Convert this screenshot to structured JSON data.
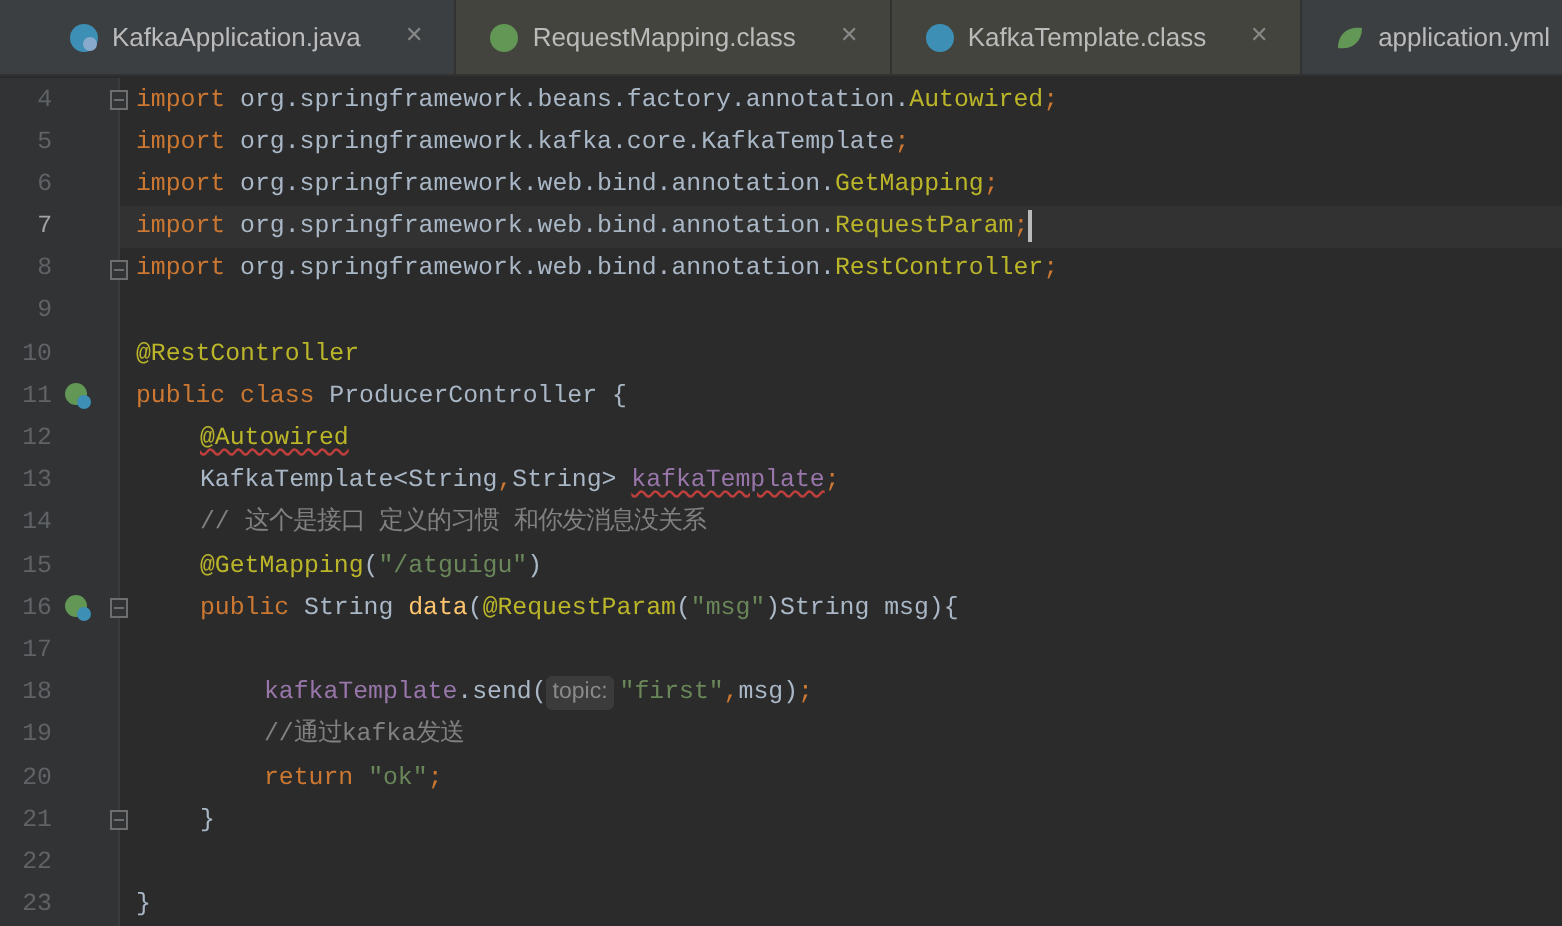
{
  "tabs": [
    {
      "label": "KafkaApplication.java",
      "kind": "app",
      "close": "✕"
    },
    {
      "label": "RequestMapping.class",
      "kind": "annotation",
      "close": "✕"
    },
    {
      "label": "KafkaTemplate.class",
      "kind": "class",
      "close": "✕"
    },
    {
      "label": "application.yml",
      "kind": "spring"
    }
  ],
  "lines": [
    {
      "number": "4",
      "kind": "top",
      "current": false,
      "fold": true,
      "tokens": [
        {
          "kind": "kw",
          "text": "import"
        },
        {
          "kind": "plain",
          "text": " org.springframework.beans.factory.annotation."
        },
        {
          "kind": "ann",
          "text": "Autowired"
        },
        {
          "kind": "punct",
          "text": ";"
        }
      ]
    },
    {
      "number": "5",
      "kind": "top",
      "current": false,
      "fold": false,
      "tokens": [
        {
          "kind": "kw",
          "text": "import"
        },
        {
          "kind": "plain",
          "text": " org.springframework.kafka.core.KafkaTemplate"
        },
        {
          "kind": "punct",
          "text": ";"
        }
      ]
    },
    {
      "number": "6",
      "kind": "top",
      "current": false,
      "fold": false,
      "tokens": [
        {
          "kind": "kw",
          "text": "import"
        },
        {
          "kind": "plain",
          "text": " org.springframework.web.bind.annotation."
        },
        {
          "kind": "ann",
          "text": "GetMapping"
        },
        {
          "kind": "punct",
          "text": ";"
        }
      ]
    },
    {
      "number": "7",
      "kind": "top",
      "current": true,
      "fold": false,
      "tokens": [
        {
          "kind": "kw",
          "text": "import"
        },
        {
          "kind": "plain",
          "text": " org.springframework.web.bind.annotation."
        },
        {
          "kind": "ann",
          "text": "RequestParam"
        },
        {
          "kind": "punct",
          "text": ";"
        }
      ]
    },
    {
      "number": "8",
      "kind": "top",
      "current": false,
      "fold": true,
      "tokens": [
        {
          "kind": "kw",
          "text": "import"
        },
        {
          "kind": "plain",
          "text": " org.springframework.web.bind.annotation."
        },
        {
          "kind": "ann",
          "text": "RestController"
        },
        {
          "kind": "punct",
          "text": ";"
        }
      ]
    },
    {
      "number": "9",
      "kind": "top",
      "current": false,
      "fold": false
    },
    {
      "number": "10",
      "kind": "top",
      "current": false,
      "fold": false,
      "tokens": [
        {
          "kind": "ann",
          "text": "@RestController"
        }
      ]
    },
    {
      "number": "11",
      "kind": "top",
      "current": false,
      "fold": false,
      "marker": true,
      "tokens": [
        {
          "kind": "kw",
          "text": "public class"
        },
        {
          "kind": "plain",
          "text": " ProducerController {"
        }
      ]
    },
    {
      "number": "12",
      "kind": "member",
      "current": false,
      "fold": false,
      "tokens": [
        {
          "kind": "ann",
          "text": "@Autowired",
          "squiggle": true
        }
      ]
    },
    {
      "number": "13",
      "kind": "member",
      "current": false,
      "fold": false,
      "tokens": [
        {
          "kind": "plain",
          "text": "KafkaTemplate<String"
        },
        {
          "kind": "punct",
          "text": ","
        },
        {
          "kind": "plain",
          "text": "String> "
        },
        {
          "kind": "field",
          "text": "kafkaTemplate",
          "squiggle": true
        },
        {
          "kind": "punct",
          "text": ";"
        }
      ]
    },
    {
      "number": "14",
      "kind": "member",
      "current": false,
      "fold": false,
      "tokens": [
        {
          "kind": "comment",
          "text": "// 这个是接口 定义的习惯 和你发消息没关系"
        }
      ]
    },
    {
      "number": "15",
      "kind": "member",
      "current": false,
      "fold": false,
      "tokens": [
        {
          "kind": "ann",
          "text": "@GetMapping"
        },
        {
          "kind": "plain",
          "text": "("
        },
        {
          "kind": "str",
          "text": "\"/atguigu\""
        },
        {
          "kind": "plain",
          "text": ")"
        }
      ]
    },
    {
      "number": "16",
      "kind": "member",
      "current": false,
      "fold": true,
      "marker": true,
      "tokens": [
        {
          "kind": "kw",
          "text": "public"
        },
        {
          "kind": "plain",
          "text": " String "
        },
        {
          "kind": "method",
          "text": "data"
        },
        {
          "kind": "plain",
          "text": "("
        },
        {
          "kind": "ann",
          "text": "@RequestParam"
        },
        {
          "kind": "plain",
          "text": "("
        },
        {
          "kind": "str",
          "text": "\"msg\""
        },
        {
          "kind": "plain",
          "text": ")String msg){"
        }
      ]
    },
    {
      "number": "17",
      "kind": "top",
      "current": false,
      "fold": false
    },
    {
      "number": "18",
      "kind": "body",
      "current": false,
      "fold": false,
      "tokens": [
        {
          "kind": "field",
          "text": "kafkaTemplate"
        },
        {
          "kind": "plain",
          "text": ".send("
        },
        {
          "kind": "hint",
          "text": "topic:"
        },
        {
          "kind": "str",
          "text": "\"first\""
        },
        {
          "kind": "punct",
          "text": ","
        },
        {
          "kind": "plain",
          "text": "msg)"
        },
        {
          "kind": "punct",
          "text": ";"
        }
      ]
    },
    {
      "number": "19",
      "kind": "body",
      "current": false,
      "fold": false,
      "tokens": [
        {
          "kind": "comment",
          "text": "//通过kafka发送"
        }
      ]
    },
    {
      "number": "20",
      "kind": "body",
      "current": false,
      "fold": false,
      "tokens": [
        {
          "kind": "kw",
          "text": "return "
        },
        {
          "kind": "str",
          "text": "\"ok\""
        },
        {
          "kind": "punct",
          "text": ";"
        }
      ]
    },
    {
      "number": "21",
      "kind": "member",
      "current": false,
      "fold": true,
      "tokens": [
        {
          "kind": "plain",
          "text": "}"
        }
      ]
    },
    {
      "number": "22",
      "kind": "top",
      "current": false,
      "fold": false
    },
    {
      "number": "23",
      "kind": "top",
      "current": false,
      "fold": false,
      "tokens": [
        {
          "kind": "plain",
          "text": "}"
        }
      ]
    }
  ]
}
